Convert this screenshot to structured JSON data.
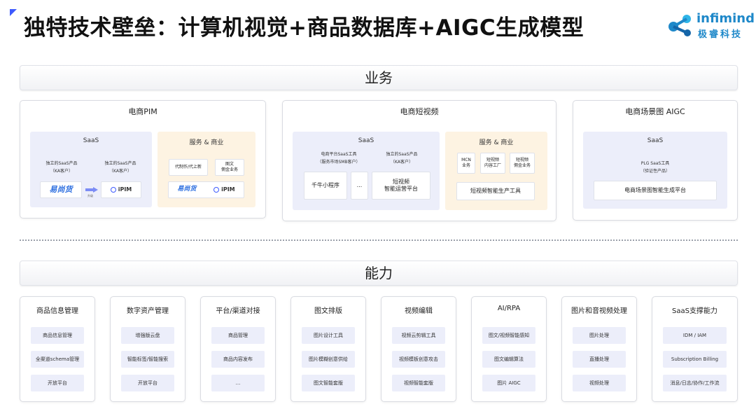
{
  "title": "独特技术壁垒：计算机视觉+商品数据库+AIGC生成模型",
  "logo": {
    "en": "infimind",
    "cn": "极睿科技"
  },
  "sections": {
    "business": "业务",
    "capability": "能力"
  },
  "business": {
    "pim": {
      "title": "电商PIM",
      "saas": {
        "title": "SaaS",
        "left_caption": "独立的SaaS产品\n（KA客户）",
        "right_caption": "独立的SaaS产品\n（KA客户）",
        "ysy_brand": "易尚货",
        "upgrade": "升级",
        "ipim_brand": "iPIM"
      },
      "service": {
        "title": "服务 & 商业",
        "item1": "代制作/代上新",
        "item2": "图文\n佣金业务",
        "ysy_brand": "易尚货",
        "ipim_brand": "iPIM"
      }
    },
    "short_video": {
      "title": "电商短视频",
      "saas": {
        "title": "SaaS",
        "left_caption": "电商平台SaaS工具\n（服务市场SMB客户）",
        "right_caption": "独立的SaaS产品\n（KA客户）",
        "qianniu": "千牛小程序",
        "ellipsis": "...",
        "platform": "短视频\n智能运营平台"
      },
      "service": {
        "title": "服务 & 商业",
        "item1": "MCN\n业务",
        "item2": "短视频\n内容工厂",
        "item3": "短视频\n佣金业务",
        "tool": "短视频智能生产工具"
      }
    },
    "aigc": {
      "title": "电商场景图 AIGC",
      "saas": {
        "title": "SaaS",
        "caption": "PLG SaaS工具\n（验证性产品）",
        "platform": "电商场景图智能生成平台"
      }
    }
  },
  "capabilities": [
    {
      "title": "商品信息管理",
      "items": [
        "商品信息管理",
        "全渠道schema管理",
        "开放平台"
      ]
    },
    {
      "title": "数字资产管理",
      "items": [
        "增强版云盘",
        "智能标签/智能搜索",
        "开放平台"
      ]
    },
    {
      "title": "平台/渠道对接",
      "items": [
        "商品管理",
        "商品内容发布",
        "..."
      ]
    },
    {
      "title": "图文排版",
      "items": [
        "图片设计工具",
        "图片模糊创意供给",
        "图文智能套版"
      ]
    },
    {
      "title": "视频编辑",
      "items": [
        "视频云剪辑工具",
        "视频模板创意攻击",
        "视频智能套版"
      ]
    },
    {
      "title": "AI/RPA",
      "items": [
        "图文/视频智能感知",
        "图文编辑算法",
        "图片 AIGC"
      ]
    },
    {
      "title": "图片和音视频处理",
      "items": [
        "图片处理",
        "直播处理",
        "视频处理"
      ]
    },
    {
      "title": "SaaS支撑能力",
      "items": [
        "IDM / IAM",
        "Subscription Billing",
        "消息/日志/协作/工作流"
      ]
    }
  ],
  "colors": {
    "accent": "#3d5afe",
    "logo": "#1e88c9",
    "saas_bg": "#eceefa",
    "service_bg": "#fdf3e2"
  }
}
